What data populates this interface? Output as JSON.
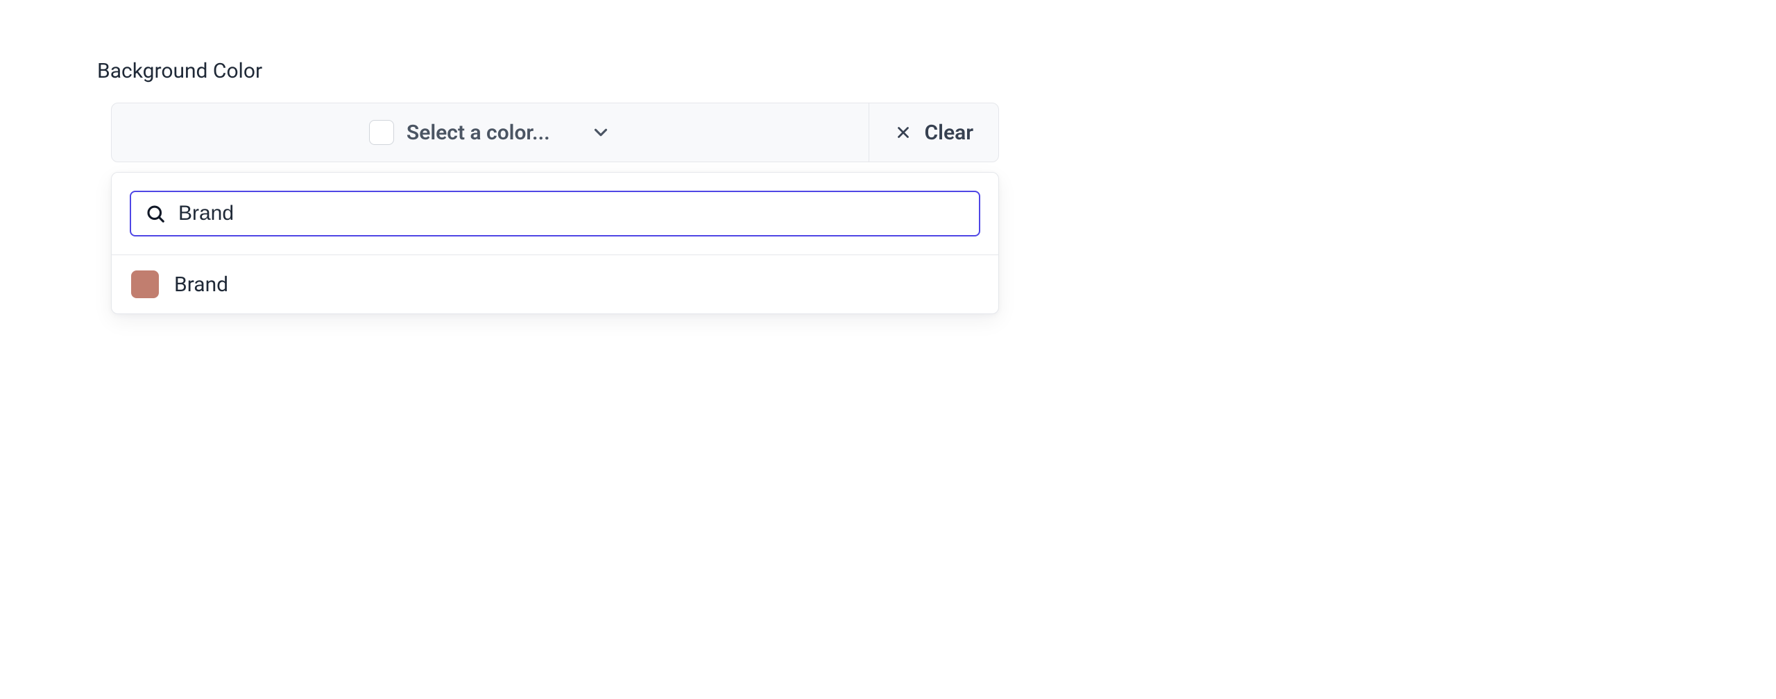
{
  "field": {
    "label": "Background Color"
  },
  "select": {
    "placeholder": "Select a color...",
    "clear_label": "Clear"
  },
  "search": {
    "value": "Brand"
  },
  "options": [
    {
      "label": "Brand",
      "swatch": "#c17e6f"
    }
  ]
}
